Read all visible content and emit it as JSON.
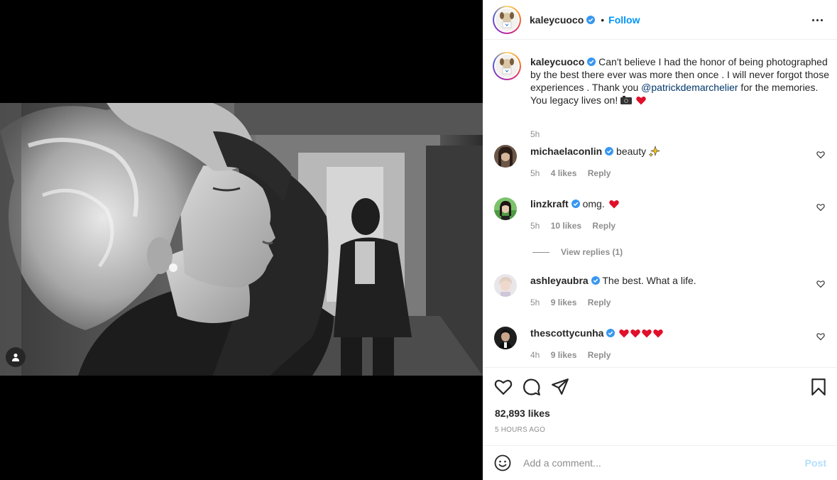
{
  "post": {
    "author": "kaleycuoco",
    "follow_label": "Follow",
    "dot": "•"
  },
  "caption": {
    "username": "kaleycuoco",
    "text_before": "Can't believe I had the honor of being photographed by the best there ever was more then once . I will never forgot those experiences . Thank you ",
    "mention": "@patrickdemarchelier",
    "text_after": " for the memories. You legacy lives on! ",
    "time": "5h"
  },
  "comments": [
    {
      "username": "michaelaconlin",
      "text": "beauty",
      "emoji": "sparkles-icon",
      "time": "5h",
      "likes": "4 likes",
      "reply": "Reply"
    },
    {
      "username": "linzkraft",
      "text": "omg.",
      "emoji": "heart-icon",
      "time": "5h",
      "likes": "10 likes",
      "reply": "Reply"
    },
    {
      "username": "ashleyaubra",
      "text": "The best. What a life.",
      "time": "5h",
      "likes": "9 likes",
      "reply": "Reply"
    },
    {
      "username": "thescottycunha",
      "text": "",
      "emoji": "heart-icon x4",
      "time": "4h",
      "likes": "9 likes",
      "reply": "Reply"
    }
  ],
  "view_replies": "View replies (1)",
  "stats": {
    "likes": "82,893 likes",
    "time_ago": "5 HOURS AGO"
  },
  "comment_box": {
    "placeholder": "Add a comment...",
    "post_label": "Post"
  },
  "colors": {
    "link_blue": "#0095f6",
    "mention": "#00376b",
    "muted": "#8e8e8e",
    "heart_red": "#ed4956"
  }
}
